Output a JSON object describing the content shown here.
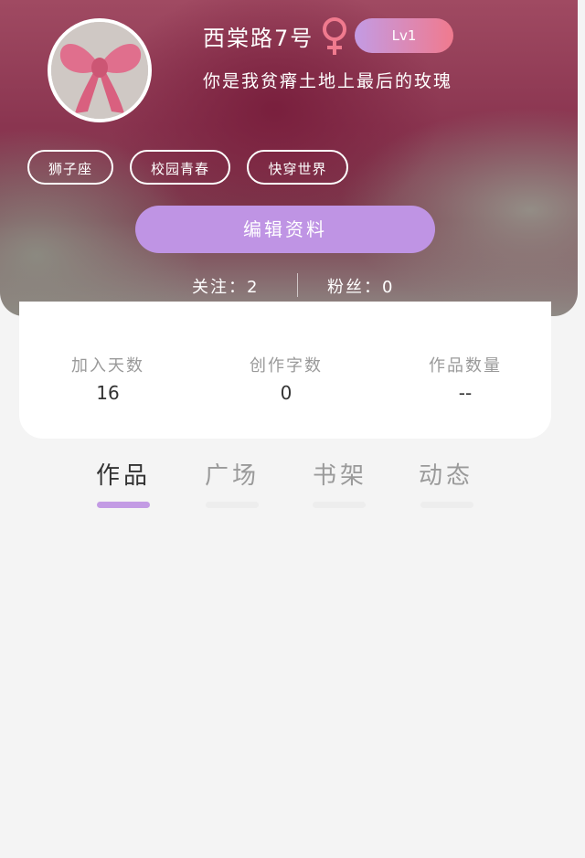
{
  "profile": {
    "name": "西棠路7号",
    "gender_icon": "female-symbol-icon",
    "level": "Lv1",
    "bio": "你是我贫瘠土地上最后的玫瑰",
    "avatar": "pink-bow-avatar"
  },
  "tags": [
    "狮子座",
    "校园青春",
    "快穿世界"
  ],
  "edit_button": "编辑资料",
  "follow": {
    "following": "关注：2",
    "fans": "粉丝：0"
  },
  "stats": [
    {
      "label": "加入天数",
      "value": "16"
    },
    {
      "label": "创作字数",
      "value": "0"
    },
    {
      "label": "作品数量",
      "value": "--"
    }
  ],
  "tabs": [
    {
      "label": "作品",
      "active": true
    },
    {
      "label": "广场",
      "active": false
    },
    {
      "label": "书架",
      "active": false
    },
    {
      "label": "动态",
      "active": false
    }
  ],
  "colors": {
    "accent": "#bf94e4",
    "level_start": "#c39be4",
    "level_end": "#f07a8e",
    "gender": "#f07a8e"
  }
}
